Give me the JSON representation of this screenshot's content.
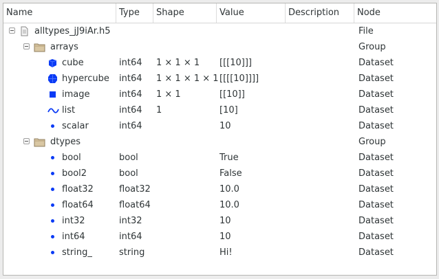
{
  "columns": [
    "Name",
    "Type",
    "Shape",
    "Value",
    "Description",
    "Node"
  ],
  "rows": [
    {
      "name": "alltypes_jJ9iAr.h5",
      "type": "",
      "shape": "",
      "value": "",
      "description": "",
      "node": "File",
      "level": 0,
      "icon": "file-icon",
      "expandable": true
    },
    {
      "name": "arrays",
      "type": "",
      "shape": "",
      "value": "",
      "description": "",
      "node": "Group",
      "level": 1,
      "icon": "folder-icon",
      "expandable": true
    },
    {
      "name": "cube",
      "type": "int64",
      "shape": "1 × 1 × 1",
      "value": "[[[10]]]",
      "description": "",
      "node": "Dataset",
      "level": 2,
      "icon": "cube-icon"
    },
    {
      "name": "hypercube",
      "type": "int64",
      "shape": "1 × 1 × 1 × 1",
      "value": "[[[[10]]]]",
      "description": "",
      "node": "Dataset",
      "level": 2,
      "icon": "hypercube-icon"
    },
    {
      "name": "image",
      "type": "int64",
      "shape": "1 × 1",
      "value": "[[10]]",
      "description": "",
      "node": "Dataset",
      "level": 2,
      "icon": "image-square-icon"
    },
    {
      "name": "list",
      "type": "int64",
      "shape": "1",
      "value": "[10]",
      "description": "",
      "node": "Dataset",
      "level": 2,
      "icon": "wave-icon"
    },
    {
      "name": "scalar",
      "type": "int64",
      "shape": "",
      "value": "10",
      "description": "",
      "node": "Dataset",
      "level": 2,
      "icon": "dot-icon"
    },
    {
      "name": "dtypes",
      "type": "",
      "shape": "",
      "value": "",
      "description": "",
      "node": "Group",
      "level": 1,
      "icon": "folder-icon",
      "expandable": true
    },
    {
      "name": "bool",
      "type": "bool",
      "shape": "",
      "value": "True",
      "description": "",
      "node": "Dataset",
      "level": 2,
      "icon": "dot-icon"
    },
    {
      "name": "bool2",
      "type": "bool",
      "shape": "",
      "value": "False",
      "description": "",
      "node": "Dataset",
      "level": 2,
      "icon": "dot-icon"
    },
    {
      "name": "float32",
      "type": "float32",
      "shape": "",
      "value": "10.0",
      "description": "",
      "node": "Dataset",
      "level": 2,
      "icon": "dot-icon"
    },
    {
      "name": "float64",
      "type": "float64",
      "shape": "",
      "value": "10.0",
      "description": "",
      "node": "Dataset",
      "level": 2,
      "icon": "dot-icon"
    },
    {
      "name": "int32",
      "type": "int32",
      "shape": "",
      "value": "10",
      "description": "",
      "node": "Dataset",
      "level": 2,
      "icon": "dot-icon"
    },
    {
      "name": "int64",
      "type": "int64",
      "shape": "",
      "value": "10",
      "description": "",
      "node": "Dataset",
      "level": 2,
      "icon": "dot-icon"
    },
    {
      "name": "string_",
      "type": "string",
      "shape": "",
      "value": "Hi!",
      "description": "",
      "node": "Dataset",
      "level": 2,
      "icon": "dot-icon"
    }
  ],
  "colors": {
    "icon_blue": "#0b3bf5",
    "folder": "#c8b48e"
  }
}
